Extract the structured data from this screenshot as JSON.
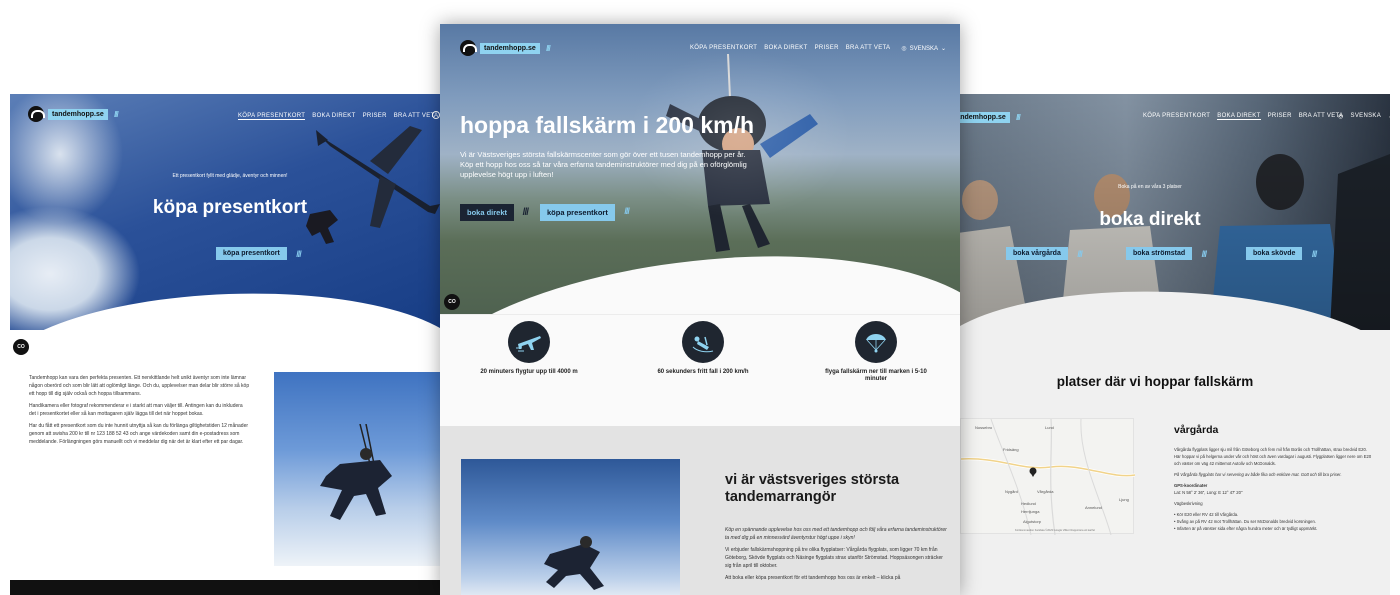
{
  "left": {
    "nav": [
      "KÖPA PRESENTKORT",
      "BOKA DIREKT",
      "PRISER",
      "BRA ATT VETA"
    ],
    "logo_text": "tandemhopp.se",
    "hero_sub": "Ett presentkort fyllt med glädje, äventyr och minnen!",
    "hero_title": "köpa presentkort",
    "cta": "köpa presentkort",
    "cc": "CO",
    "paragraphs": [
      "Tandemhopp kan vara den perfekta presenten. Ett nervkittlande helt unikt äventyr som inte lämnar någon oberörd och som blir lätt att oglömligt länge. Och du, upplevelser man delar blir större så köp ett hopp till dig själv också och hoppa tillsammans.",
      "Handikamera eller fotograf rekommenderar e i starkt att man väljer till. Antingen kan du inkludera det i presentkortet eller så kan mottagaren själv lägga till det när hoppet bokas.",
      "Har du fått ett presentkort som du inte hunnit utnyttja så kan du förlänga giltighetstiden 12 månader genom att swisha 200 kr till nr 123 188 52 43 och ange värdekoden samt din e-postadress som meddelande. Förlängningen görs manuellt och vi meddelar dig när det är klart efter ett par dagar."
    ]
  },
  "center": {
    "logo_text": "tandemhopp.se",
    "nav": [
      "KÖPA PRESENTKORT",
      "BOKA DIREKT",
      "PRISER",
      "BRA ATT VETA"
    ],
    "language": "SVENSKA",
    "hero_title": "hoppa fallskärm i 200 km/h",
    "hero_sub": "Vi är Västsveriges största fallskärmscenter som gör över ett tusen tandemhopp per år. Köp ett hopp hos oss så tar våra erfarna tandeminstruktörer med dig på en oförglömlig upplevelse högt upp i luften!",
    "cta_dark": "boka direkt",
    "cta_blue": "köpa presentkort",
    "cc": "CO",
    "features": [
      {
        "icon": "airplane-icon",
        "label": "20 minuters flygtur upp till 4000 m"
      },
      {
        "icon": "freefall-icon",
        "label": "60 sekunders fritt fall i 200 km/h"
      },
      {
        "icon": "parachute-icon",
        "label": "flyga fallskärm ner till marken i 5-10 minuter"
      }
    ],
    "section_title": "vi är västsveriges största tandemarrangör",
    "body": [
      "Köp en spännande upplevelse hos oss med ett tandemhopp och följ våra erfarna tandeminstruktörer ta med dig på en minnesvärd äventyrstur högt uppe i skyn!",
      "Vi erbjuder fallskärmshoppning på tre olika flygplatser: Vårgårda flygplats, som ligger 70 km från Göteborg, Skövde flygplats och Näsinge flygplats strax utanför Strömstad. Hoppsäsongen sträcker sig från april till oktober.",
      "Att boka eller köpa presentkort för ett tandemhopp hos oss är enkelt – klicka på"
    ]
  },
  "right": {
    "logo_text": "tandemhopp.se",
    "nav": [
      "KÖPA PRESENTKORT",
      "BOKA DIREKT",
      "PRISER",
      "BRA ATT VETA"
    ],
    "language": "SVENSKA",
    "hero_sub": "Boka på en av våra 3 platser",
    "hero_title": "boka direkt",
    "buttons": [
      "boka vårgårda",
      "boka strömstad",
      "boka skövde"
    ],
    "section_title": "platser där vi hoppar fallskärm",
    "map_labels": [
      "Nossebro",
      "Lund",
      "Fridsäng",
      "Vårgårda",
      "Nygård",
      "Hedlund",
      "Herrljunga",
      "Algutstorp",
      "Annelund",
      "Ljung"
    ],
    "map_footer": "Kortkommandon   Kartdata ©2023 Google   Villkor   Rapportera ett kartfel",
    "venue_title": "vårgårda",
    "venue_text": [
      "Vårgårda flygplats ligger sju mil från Göteborg och fem mil från Borås och Trollhättan, strax bredvid E20. Här hoppar vi på helgerna under vår och höst och även vardagar i augusti. Flygplatsen ligger nere om E20 och väster om väg 42 mittemot Autoliv och McDonalds.",
      "På Vårgårda flygplats har vi servering av både fika och enklare mat. Gott och till bra priser.",
      "GPS-koordinater",
      "Lat: N 58° 2' 36\", Long: E 12° 47' 20\"",
      "Vägbeskrivning",
      "Kör E20 eller RV 42 till Vårgårda.",
      "Svång av på RV 42 mot Trollhättan. Du ser McDonalds bredvid korsningen.",
      "Infarten är på vänster sida efter några hundra meter och är tydligt uppmärkt."
    ]
  }
}
